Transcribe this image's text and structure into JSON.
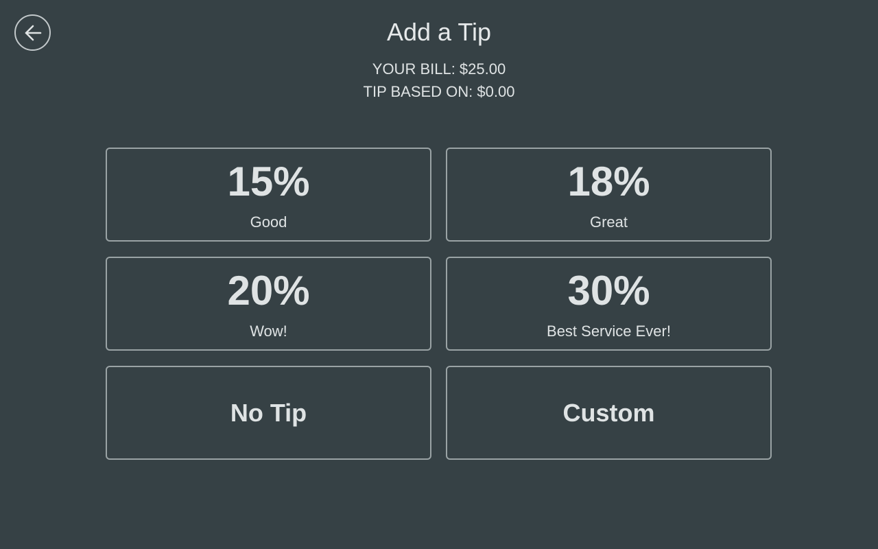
{
  "header": {
    "back_icon": "arrow-left-circle-icon",
    "title": "Add a Tip",
    "bill_line": "YOUR BILL: $25.00",
    "tip_based_line": "TIP BASED ON: $0.00"
  },
  "tip_options": [
    {
      "percent": "15%",
      "label": "Good"
    },
    {
      "percent": "18%",
      "label": "Great"
    },
    {
      "percent": "20%",
      "label": "Wow!"
    },
    {
      "percent": "30%",
      "label": "Best Service Ever!"
    }
  ],
  "actions": {
    "no_tip_label": "No Tip",
    "custom_label": "Custom"
  },
  "colors": {
    "background": "#364145",
    "text": "#dfe3e4",
    "border": "#9aa3a5"
  }
}
